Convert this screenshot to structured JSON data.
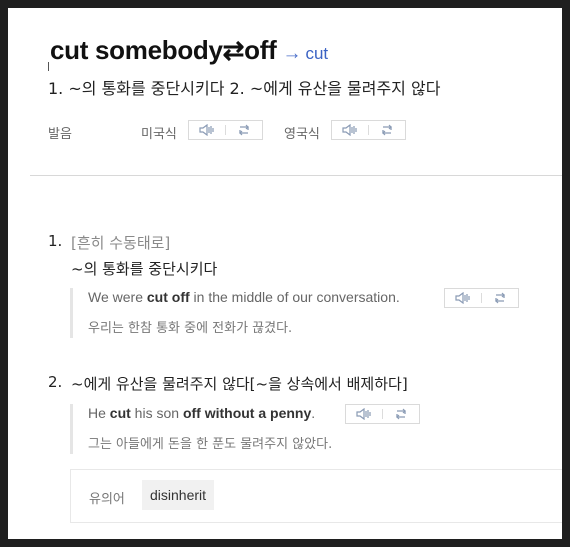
{
  "entry": {
    "head_word": "cut somebody⇄off",
    "arrow": "→",
    "link_word": "cut",
    "summary": "1. ~의 통화를 중단시키다 2. ~에게 유산을 물려주지 않다"
  },
  "pronunciation": {
    "label": "발음",
    "us_label": "미국식",
    "uk_label": "영국식"
  },
  "senses": [
    {
      "number": "1.",
      "grammar": "[흔히 수동태로]",
      "definition": "~의 통화를 중단시키다",
      "example": {
        "en_parts": [
          "We were ",
          "cut off",
          " in the middle of our conversation."
        ],
        "ko": "우리는 한참 통화 중에 전화가 끊겼다."
      }
    },
    {
      "number": "2.",
      "definition": "~에게 유산을 물려주지 않다[~을 상속에서 배제하다]",
      "example": {
        "en_parts": [
          "He ",
          "cut",
          " his son ",
          "off without a penny",
          "."
        ],
        "ko": "그는 아들에게 돈을 한 푼도 물려주지 않았다."
      }
    }
  ],
  "synonyms": {
    "label": "유의어",
    "items": [
      "disinherit"
    ]
  },
  "icons": {
    "play": "speaker-icon",
    "repeat": "repeat-icon"
  },
  "colors": {
    "link": "#3b63c4",
    "background": "#1f1f1f",
    "panel": "#ffffff"
  }
}
